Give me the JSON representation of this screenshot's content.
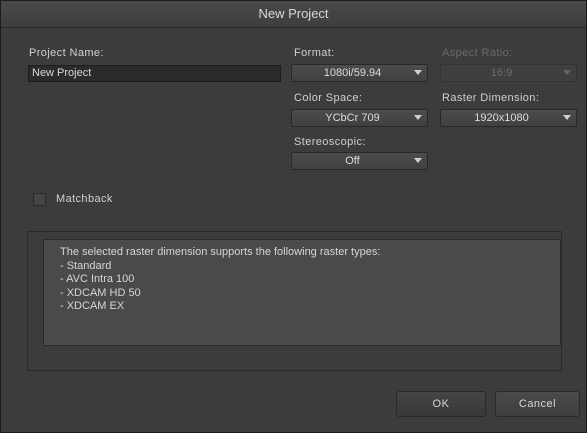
{
  "window": {
    "title": "New Project"
  },
  "project_name": {
    "label": "Project Name:",
    "value": "New Project"
  },
  "format": {
    "label": "Format:",
    "value": "1080i/59.94"
  },
  "aspect_ratio": {
    "label": "Aspect Ratio:",
    "value": "16:9"
  },
  "color_space": {
    "label": "Color Space:",
    "value": "YCbCr 709"
  },
  "raster_dimension": {
    "label": "Raster Dimension:",
    "value": "1920x1080"
  },
  "stereoscopic": {
    "label": "Stereoscopic:",
    "value": "Off"
  },
  "matchback": {
    "label": "Matchback",
    "checked": false
  },
  "info": {
    "heading": "The selected raster dimension supports the following raster types:",
    "items": [
      "- Standard",
      "- AVC Intra 100",
      "- XDCAM HD 50",
      "- XDCAM EX"
    ]
  },
  "buttons": {
    "ok": "OK",
    "cancel": "Cancel"
  }
}
